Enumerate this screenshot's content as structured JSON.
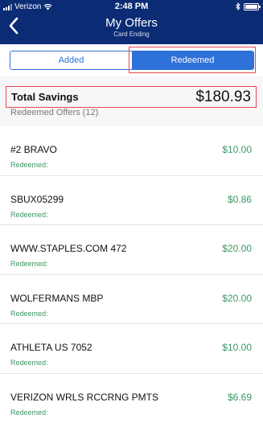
{
  "status_bar": {
    "carrier": "Verizon",
    "time": "2:48 PM"
  },
  "header": {
    "title": "My Offers",
    "subtitle": "Card Ending"
  },
  "tabs": [
    {
      "label": "Added"
    },
    {
      "label": "Redeemed"
    }
  ],
  "summary": {
    "label": "Total Savings",
    "amount": "$180.93",
    "count_text": "Redeemed Offers (12)"
  },
  "offers": [
    {
      "merchant": "#2 BRAVO",
      "amount": "$10.00",
      "status": "Redeemed:"
    },
    {
      "merchant": "SBUX05299",
      "amount": "$0.86",
      "status": "Redeemed:"
    },
    {
      "merchant": "WWW.STAPLES.COM 472",
      "amount": "$20.00",
      "status": "Redeemed:"
    },
    {
      "merchant": "WOLFERMANS MBP",
      "amount": "$20.00",
      "status": "Redeemed:"
    },
    {
      "merchant": "ATHLETA US 7052",
      "amount": "$10.00",
      "status": "Redeemed:"
    },
    {
      "merchant": "VERIZON WRLS RCCRNG PMTS",
      "amount": "$6.69",
      "status": "Redeemed:"
    }
  ],
  "colors": {
    "header": "#0b2c75",
    "accent": "#2e71d9",
    "amount": "#3c9764",
    "highlight": "#e9474b"
  },
  "icons": {
    "back": "chevron-left-icon",
    "wifi": "wifi-icon",
    "bluetooth": "bluetooth-icon",
    "battery": "battery-icon",
    "signal": "signal-icon"
  }
}
